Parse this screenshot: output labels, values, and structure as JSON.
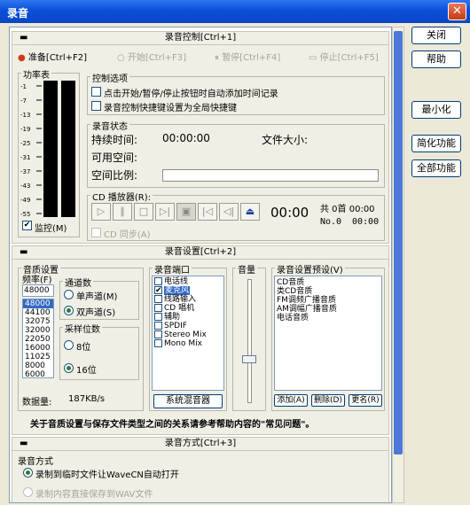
{
  "window": {
    "title": "录音",
    "close_glyph": "✕"
  },
  "right_buttons": {
    "close": "关闭",
    "help": "帮助",
    "minimize": "最小化",
    "simplify": "简化功能",
    "all": "全部功能"
  },
  "control": {
    "header": "录音控制[Ctrl+1]",
    "tabs": [
      "准备[Ctrl+F2]",
      "开始[Ctrl+F3]",
      "暂停[Ctrl+F4]",
      "停止[Ctrl+F5]"
    ],
    "power_title": "功率表",
    "meter_ticks": [
      "-1",
      "-7",
      "-13",
      "-19",
      "-25",
      "-31",
      "-37",
      "-43",
      "-49",
      "-55"
    ],
    "monitor": "监控(M)",
    "options_title": "控制选项",
    "option1": "点击开始/暂停/停止按钮时自动添加时间记录",
    "option2": "录音控制快捷键设置为全局快捷键",
    "status_title": "录音状态",
    "duration_label": "持续时间:",
    "duration_value": "00:00:00",
    "filesize_label": "文件大小:",
    "available_label": "可用空间:",
    "space_label": "空间比例:",
    "cd_title": "CD 播放器(R):",
    "cd_time": "00:00",
    "cd_total": "共 0首 00:00",
    "cd_no": "No.0",
    "cd_no_time": "00:00",
    "cd_sync": "CD 同步(A)"
  },
  "settings": {
    "header": "录音设置[Ctrl+2]",
    "quality_title": "音质设置",
    "freq_label": "频率(F)",
    "freq_value": "48000",
    "freq_list": [
      "48000",
      "44100",
      "32075",
      "32000",
      "22050",
      "16000",
      "11025",
      "8000",
      "6000"
    ],
    "channel_title": "通道数",
    "mono": "单声道(M)",
    "stereo": "双声道(S)",
    "bits_title": "采样位数",
    "bit8": "8位",
    "bit16": "16位",
    "datarate_label": "数据量:",
    "datarate_value": "187KB/s",
    "port_title": "录音端口",
    "ports": [
      "电话线",
      "麦克风",
      "线路输入",
      "CD 唱机",
      "辅助",
      "SPDIF",
      "Stereo Mix",
      "Mono Mix"
    ],
    "mixer_button": "系统混音器",
    "volume_title": "音量",
    "preset_title": "录音设置预设(V)",
    "presets": [
      "CD音质",
      "类CD音质",
      "FM调频广播音质",
      "AM调幅广播音质",
      "电话音质"
    ],
    "add": "添加(A)",
    "delete": "删除(D)",
    "rename": "更名(R)",
    "note": "关于音质设置与保存文件类型之间的关系请参考帮助内容的\"常见问题\"。"
  },
  "method": {
    "header": "录音方式[Ctrl+3]",
    "title": "录音方式",
    "option1": "录制到临时文件让WaveCN自动打开",
    "option2": "录制内容直接保存到WAV文件"
  }
}
